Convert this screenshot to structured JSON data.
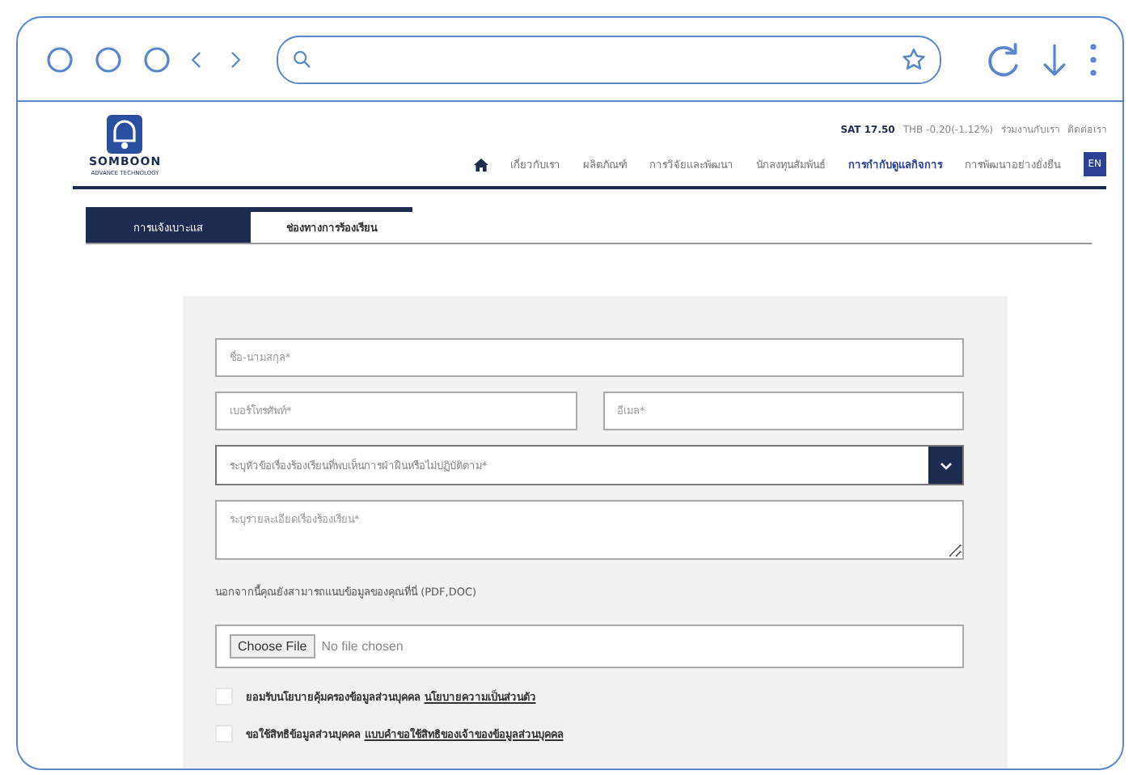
{
  "header": {
    "logo": {
      "name": "SOMBOON",
      "tagline": "ADVANCE TECHNOLOGY"
    },
    "stock": {
      "quote": "SAT 17.50",
      "change": "THB -0.20(-1.12%)"
    },
    "top_links": [
      "ร่วมงานกับเรา",
      "ติดต่อเรา"
    ],
    "nav": [
      {
        "label": "เกี่ยวกับเรา",
        "selected": false
      },
      {
        "label": "ผลิตภัณฑ์",
        "selected": false
      },
      {
        "label": "การวิจัยและพัฒนา",
        "selected": false
      },
      {
        "label": "นักลงทุนสัมพันธ์",
        "selected": false
      },
      {
        "label": "การกำกับดูแลกิจการ",
        "selected": true
      },
      {
        "label": "การพัฒนาอย่างยั่งยืน",
        "selected": false
      }
    ],
    "language": "EN"
  },
  "tabs": [
    {
      "label": "การแจ้งเบาะแส",
      "selected": true
    },
    {
      "label": "ช่องทางการร้องเรียน",
      "selected": false
    }
  ],
  "form": {
    "rows": [
      [
        {
          "kind": "input",
          "placeholder": "ชื่อ-นามสกุล*"
        }
      ],
      [
        {
          "kind": "input",
          "placeholder": "เบอร์โทรศัพท์*"
        },
        {
          "kind": "input",
          "placeholder": "อีเมล*"
        }
      ],
      [
        {
          "kind": "select",
          "placeholder": "ระบุหัวข้อเรื่องร้องเรียนที่พบเห็นการฝ่าฝืนหรือไม่ปฏิบัติตาม*"
        }
      ],
      [
        {
          "kind": "textarea",
          "placeholder": "ระบุรายละเอียดเรื่องร้องเรียน*"
        }
      ]
    ],
    "attach_label": "นอกจากนี้คุณยังสามารถแนบข้อมูลของคุณที่นี่ (PDF,DOC)",
    "file": {
      "button": "Choose File",
      "status": "No file chosen"
    },
    "consents": [
      {
        "text": "ยอมรับนโยบายคุ้มครองข้อมูลส่วนบุคคล",
        "link": "นโยบายความเป็นส่วนตัว",
        "checked": false
      },
      {
        "text": "ขอใช้สิทธิข้อมูลส่วนบุคคล",
        "link": "แบบคำขอใช้สิทธิของเจ้าของข้อมูลส่วนบุคคล",
        "checked": false
      }
    ]
  }
}
